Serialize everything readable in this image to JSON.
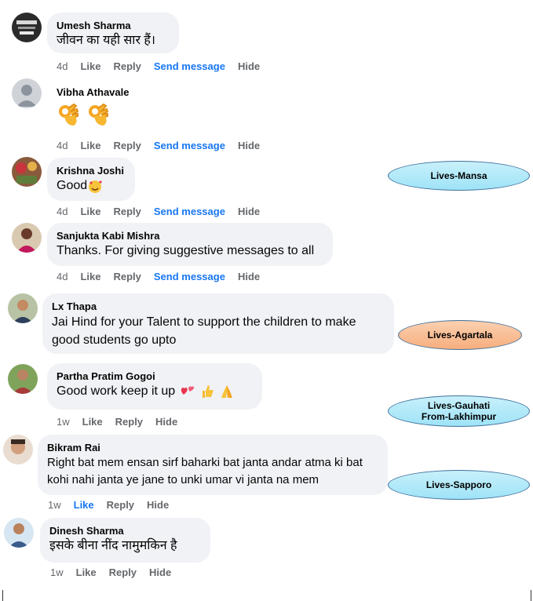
{
  "comments": [
    {
      "name": "Umesh Sharma",
      "text": "जीवन का यही सार हैं।",
      "time": "4d",
      "like": "Like",
      "reply": "Reply",
      "send": "Send message",
      "hide": "Hide"
    },
    {
      "name": "Vibha Athavale",
      "text": "",
      "time": "4d",
      "like": "Like",
      "reply": "Reply",
      "send": "Send message",
      "hide": "Hide"
    },
    {
      "name": "Krishna Joshi",
      "text": "Good",
      "time": "4d",
      "like": "Like",
      "reply": "Reply",
      "send": "Send message",
      "hide": "Hide"
    },
    {
      "name": "Sanjukta Kabi Mishra",
      "text": "Thanks. For giving suggestive messages to all",
      "time": "4d",
      "like": "Like",
      "reply": "Reply",
      "send": "Send message",
      "hide": "Hide"
    },
    {
      "name": "Lx Thapa",
      "text": "Jai Hind for your Talent to support the children to make good students go upto"
    },
    {
      "name": "Partha Pratim Gogoi",
      "text": "Good work keep it up",
      "time": "1w",
      "like": "Like",
      "reply": "Reply",
      "hide": "Hide"
    },
    {
      "name": "Bikram Rai",
      "text": "Right bat mem ensan sirf baharki bat janta andar atma ki bat kohi nahi janta ye jane to unki umar vi janta na mem",
      "time": "1w",
      "like": "Like",
      "reply": "Reply",
      "hide": "Hide"
    },
    {
      "name": "Dinesh Sharma",
      "text": "इसके बीना नींद नामुमकिन है",
      "time": "1w",
      "like": "Like",
      "reply": "Reply",
      "hide": "Hide"
    }
  ],
  "annotations": [
    {
      "label": "Lives-Mansa"
    },
    {
      "label": "Lives-Agartala"
    },
    {
      "label": "Lives-Gauhati\nFrom-Lakhimpur"
    },
    {
      "label": "Lives-Sapporo"
    }
  ],
  "colors": {
    "bubble": "#f0f2f5",
    "action_gray": "#65676b",
    "link_blue": "#1877f2",
    "callout_blue": "#bdeefa",
    "callout_orange": "#f8b98a"
  },
  "icons": [
    "ok-hand-emoji",
    "smiling-face-with-hearts-emoji",
    "two-hearts-emoji",
    "thumbs-up-emoji",
    "folded-hands-emoji"
  ]
}
